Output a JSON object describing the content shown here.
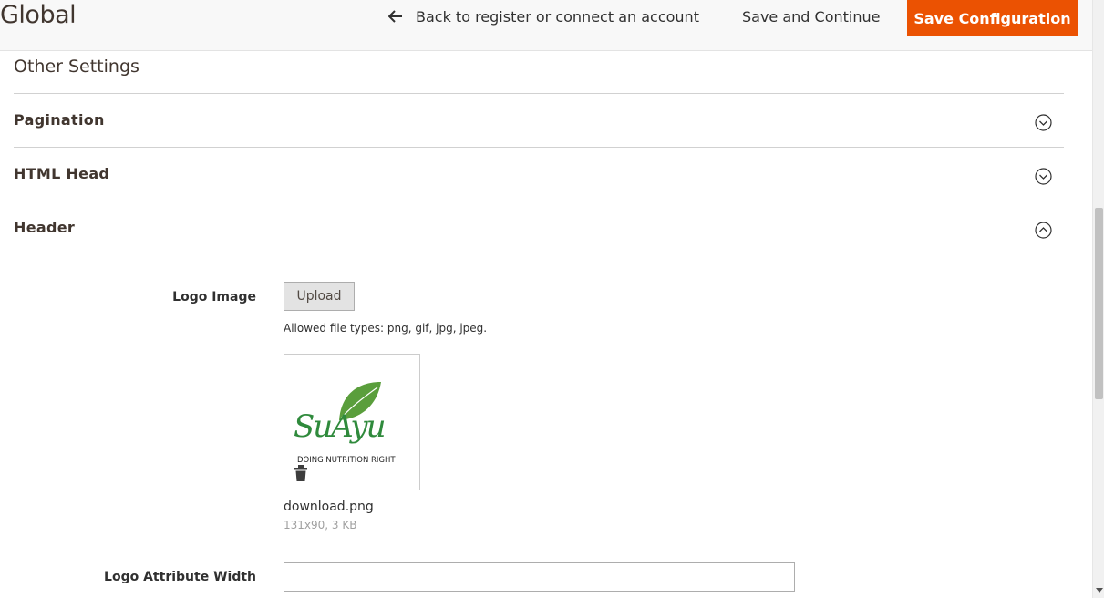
{
  "header": {
    "title": "Global",
    "back_label": "Back to register or connect an account",
    "save_continue_label": "Save and Continue",
    "save_config_label": "Save Configuration",
    "accent_color": "#eb5202"
  },
  "section": {
    "heading": "Other Settings",
    "groups": [
      {
        "title": "Pagination",
        "state": "collapsed",
        "icon": "chevron-down-circle-icon"
      },
      {
        "title": "HTML Head",
        "state": "collapsed",
        "icon": "chevron-down-circle-icon"
      },
      {
        "title": "Header",
        "state": "expanded",
        "icon": "chevron-up-circle-icon"
      }
    ]
  },
  "header_group": {
    "logo_label": "Logo Image",
    "upload_label": "Upload",
    "allowed_types": "Allowed file types: png, gif, jpg, jpeg.",
    "logo_text": "SuAyu",
    "logo_tagline": "DOING NUTRITION RIGHT",
    "file_name": "download.png",
    "file_meta": "131x90, 3 KB",
    "width_label": "Logo Attribute Width",
    "width_value": ""
  }
}
